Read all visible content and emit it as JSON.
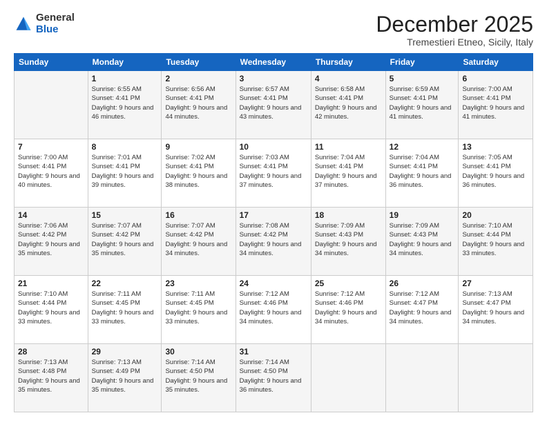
{
  "logo": {
    "general": "General",
    "blue": "Blue"
  },
  "header": {
    "month": "December 2025",
    "location": "Tremestieri Etneo, Sicily, Italy"
  },
  "days_of_week": [
    "Sunday",
    "Monday",
    "Tuesday",
    "Wednesday",
    "Thursday",
    "Friday",
    "Saturday"
  ],
  "weeks": [
    [
      {
        "day": "",
        "sunrise": "",
        "sunset": "",
        "daylight": ""
      },
      {
        "day": "1",
        "sunrise": "Sunrise: 6:55 AM",
        "sunset": "Sunset: 4:41 PM",
        "daylight": "Daylight: 9 hours and 46 minutes."
      },
      {
        "day": "2",
        "sunrise": "Sunrise: 6:56 AM",
        "sunset": "Sunset: 4:41 PM",
        "daylight": "Daylight: 9 hours and 44 minutes."
      },
      {
        "day": "3",
        "sunrise": "Sunrise: 6:57 AM",
        "sunset": "Sunset: 4:41 PM",
        "daylight": "Daylight: 9 hours and 43 minutes."
      },
      {
        "day": "4",
        "sunrise": "Sunrise: 6:58 AM",
        "sunset": "Sunset: 4:41 PM",
        "daylight": "Daylight: 9 hours and 42 minutes."
      },
      {
        "day": "5",
        "sunrise": "Sunrise: 6:59 AM",
        "sunset": "Sunset: 4:41 PM",
        "daylight": "Daylight: 9 hours and 41 minutes."
      },
      {
        "day": "6",
        "sunrise": "Sunrise: 7:00 AM",
        "sunset": "Sunset: 4:41 PM",
        "daylight": "Daylight: 9 hours and 41 minutes."
      }
    ],
    [
      {
        "day": "7",
        "sunrise": "Sunrise: 7:00 AM",
        "sunset": "Sunset: 4:41 PM",
        "daylight": "Daylight: 9 hours and 40 minutes."
      },
      {
        "day": "8",
        "sunrise": "Sunrise: 7:01 AM",
        "sunset": "Sunset: 4:41 PM",
        "daylight": "Daylight: 9 hours and 39 minutes."
      },
      {
        "day": "9",
        "sunrise": "Sunrise: 7:02 AM",
        "sunset": "Sunset: 4:41 PM",
        "daylight": "Daylight: 9 hours and 38 minutes."
      },
      {
        "day": "10",
        "sunrise": "Sunrise: 7:03 AM",
        "sunset": "Sunset: 4:41 PM",
        "daylight": "Daylight: 9 hours and 37 minutes."
      },
      {
        "day": "11",
        "sunrise": "Sunrise: 7:04 AM",
        "sunset": "Sunset: 4:41 PM",
        "daylight": "Daylight: 9 hours and 37 minutes."
      },
      {
        "day": "12",
        "sunrise": "Sunrise: 7:04 AM",
        "sunset": "Sunset: 4:41 PM",
        "daylight": "Daylight: 9 hours and 36 minutes."
      },
      {
        "day": "13",
        "sunrise": "Sunrise: 7:05 AM",
        "sunset": "Sunset: 4:41 PM",
        "daylight": "Daylight: 9 hours and 36 minutes."
      }
    ],
    [
      {
        "day": "14",
        "sunrise": "Sunrise: 7:06 AM",
        "sunset": "Sunset: 4:42 PM",
        "daylight": "Daylight: 9 hours and 35 minutes."
      },
      {
        "day": "15",
        "sunrise": "Sunrise: 7:07 AM",
        "sunset": "Sunset: 4:42 PM",
        "daylight": "Daylight: 9 hours and 35 minutes."
      },
      {
        "day": "16",
        "sunrise": "Sunrise: 7:07 AM",
        "sunset": "Sunset: 4:42 PM",
        "daylight": "Daylight: 9 hours and 34 minutes."
      },
      {
        "day": "17",
        "sunrise": "Sunrise: 7:08 AM",
        "sunset": "Sunset: 4:42 PM",
        "daylight": "Daylight: 9 hours and 34 minutes."
      },
      {
        "day": "18",
        "sunrise": "Sunrise: 7:09 AM",
        "sunset": "Sunset: 4:43 PM",
        "daylight": "Daylight: 9 hours and 34 minutes."
      },
      {
        "day": "19",
        "sunrise": "Sunrise: 7:09 AM",
        "sunset": "Sunset: 4:43 PM",
        "daylight": "Daylight: 9 hours and 34 minutes."
      },
      {
        "day": "20",
        "sunrise": "Sunrise: 7:10 AM",
        "sunset": "Sunset: 4:44 PM",
        "daylight": "Daylight: 9 hours and 33 minutes."
      }
    ],
    [
      {
        "day": "21",
        "sunrise": "Sunrise: 7:10 AM",
        "sunset": "Sunset: 4:44 PM",
        "daylight": "Daylight: 9 hours and 33 minutes."
      },
      {
        "day": "22",
        "sunrise": "Sunrise: 7:11 AM",
        "sunset": "Sunset: 4:45 PM",
        "daylight": "Daylight: 9 hours and 33 minutes."
      },
      {
        "day": "23",
        "sunrise": "Sunrise: 7:11 AM",
        "sunset": "Sunset: 4:45 PM",
        "daylight": "Daylight: 9 hours and 33 minutes."
      },
      {
        "day": "24",
        "sunrise": "Sunrise: 7:12 AM",
        "sunset": "Sunset: 4:46 PM",
        "daylight": "Daylight: 9 hours and 34 minutes."
      },
      {
        "day": "25",
        "sunrise": "Sunrise: 7:12 AM",
        "sunset": "Sunset: 4:46 PM",
        "daylight": "Daylight: 9 hours and 34 minutes."
      },
      {
        "day": "26",
        "sunrise": "Sunrise: 7:12 AM",
        "sunset": "Sunset: 4:47 PM",
        "daylight": "Daylight: 9 hours and 34 minutes."
      },
      {
        "day": "27",
        "sunrise": "Sunrise: 7:13 AM",
        "sunset": "Sunset: 4:47 PM",
        "daylight": "Daylight: 9 hours and 34 minutes."
      }
    ],
    [
      {
        "day": "28",
        "sunrise": "Sunrise: 7:13 AM",
        "sunset": "Sunset: 4:48 PM",
        "daylight": "Daylight: 9 hours and 35 minutes."
      },
      {
        "day": "29",
        "sunrise": "Sunrise: 7:13 AM",
        "sunset": "Sunset: 4:49 PM",
        "daylight": "Daylight: 9 hours and 35 minutes."
      },
      {
        "day": "30",
        "sunrise": "Sunrise: 7:14 AM",
        "sunset": "Sunset: 4:50 PM",
        "daylight": "Daylight: 9 hours and 35 minutes."
      },
      {
        "day": "31",
        "sunrise": "Sunrise: 7:14 AM",
        "sunset": "Sunset: 4:50 PM",
        "daylight": "Daylight: 9 hours and 36 minutes."
      },
      {
        "day": "",
        "sunrise": "",
        "sunset": "",
        "daylight": ""
      },
      {
        "day": "",
        "sunrise": "",
        "sunset": "",
        "daylight": ""
      },
      {
        "day": "",
        "sunrise": "",
        "sunset": "",
        "daylight": ""
      }
    ]
  ]
}
